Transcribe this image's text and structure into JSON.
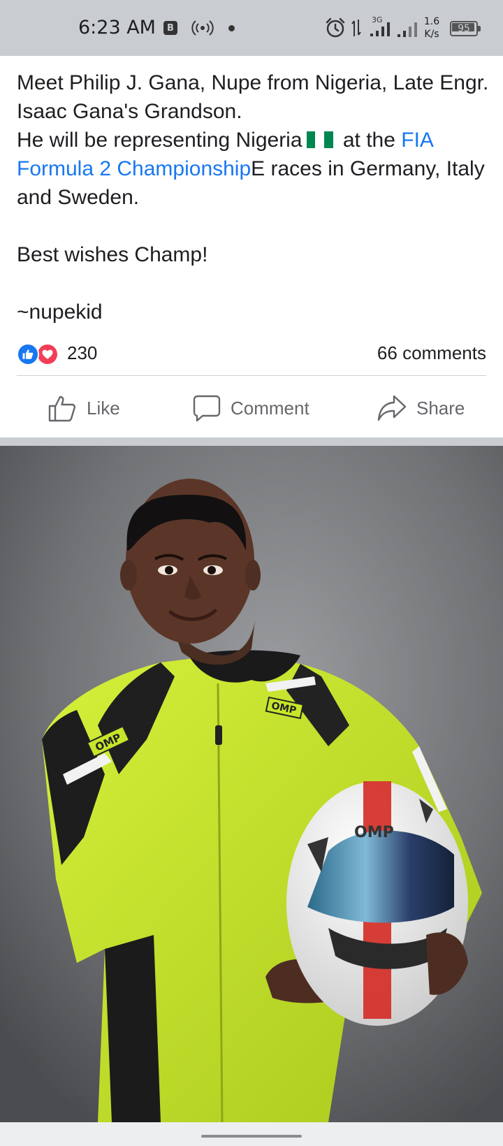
{
  "status_bar": {
    "time": "6:23 AM",
    "b_badge": "B",
    "network": "3G",
    "speed_value": "1.6",
    "speed_unit": "K/s",
    "battery_level": "95",
    "battery_fraction": 0.95,
    "icons": [
      "b-badge-icon",
      "hotspot-icon",
      "dot-icon",
      "alarm-icon",
      "data-arrows-icon",
      "signal-icon",
      "battery-icon"
    ]
  },
  "post": {
    "line1": "Meet Philip J. Gana, Nupe from Nigeria, Late Engr. Isaac Gana's Grandson.",
    "line2_start": "He will be representing Nigeria",
    "line2_mid": " at the ",
    "link_text": "FIA Formula 2 Championship",
    "line2_end": "E races in Germany, Italy and Sweden.",
    "line3": "Best wishes Champ!",
    "signature": "~nupekid",
    "flag_colors": [
      "#008751",
      "#ffffff",
      "#008751"
    ]
  },
  "reactions": {
    "count": "230",
    "comments": "66 comments",
    "like_color": "#1877f2",
    "love_color": "#f33e58"
  },
  "actions": {
    "like": "Like",
    "comment": "Comment",
    "share": "Share"
  },
  "photo": {
    "suit_brand": "OMP",
    "helmet_brand": "OMP",
    "suit_color": "#c6e62a",
    "background_color": "#6e7073"
  }
}
